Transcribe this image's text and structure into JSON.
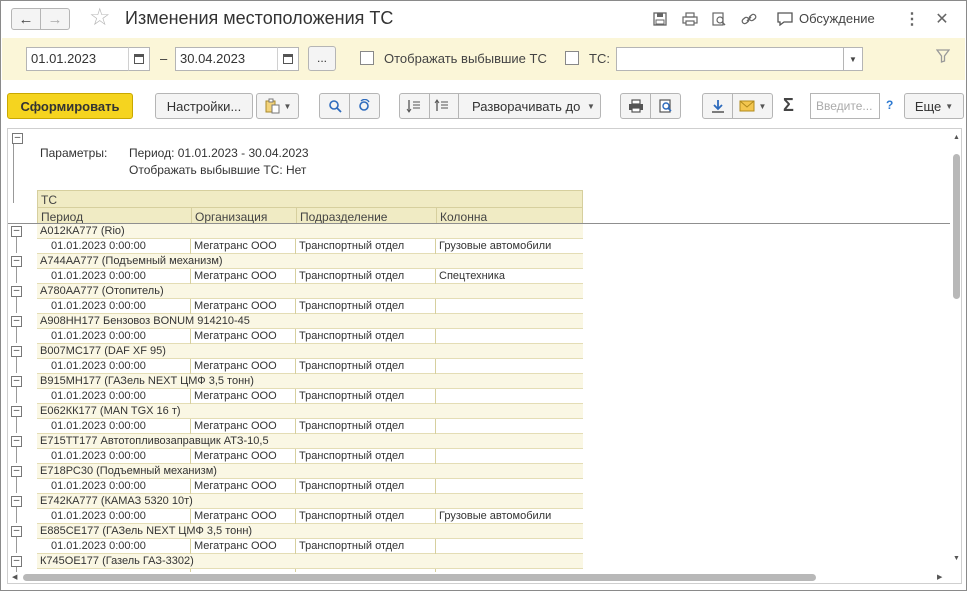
{
  "window": {
    "title": "Изменения местоположения ТС",
    "discuss_label": "Обсуждение"
  },
  "filters": {
    "date_from": "01.01.2023",
    "date_to": "30.04.2023",
    "dash": "–",
    "dots": "...",
    "show_retired_label": "Отображать выбывшие ТС",
    "ts_label": "ТС:",
    "ts_value": ""
  },
  "toolbar": {
    "generate": "Сформировать",
    "settings": "Настройки...",
    "expand_to": "Разворачивать до",
    "search_placeholder": "Введите...",
    "help": "?",
    "more": "Еще",
    "sigma": "Σ"
  },
  "report": {
    "params_label": "Параметры:",
    "period_line": "Период: 01.01.2023 - 30.04.2023",
    "retired_line": "Отображать выбывшие ТС: Нет",
    "header_group": "ТС",
    "columns": [
      "Период",
      "Организация",
      "Подразделение",
      "Колонна"
    ],
    "groups": [
      {
        "name": "А012КА777 (Rio)",
        "row": [
          "01.01.2023 0:00:00",
          "Мегатранс ООО",
          "Транспортный отдел",
          "Грузовые автомобили"
        ]
      },
      {
        "name": "А744АА777 (Подъемный механизм)",
        "row": [
          "01.01.2023 0:00:00",
          "Мегатранс ООО",
          "Транспортный отдел",
          "Спецтехника"
        ]
      },
      {
        "name": "А780АА777 (Отопитель)",
        "row": [
          "01.01.2023 0:00:00",
          "Мегатранс ООО",
          "Транспортный отдел",
          ""
        ]
      },
      {
        "name": "А908НН177 Бензовоз BONUM 914210-45",
        "row": [
          "01.01.2023 0:00:00",
          "Мегатранс ООО",
          "Транспортный отдел",
          ""
        ]
      },
      {
        "name": "В007МС177 (DAF XF 95)",
        "row": [
          "01.01.2023 0:00:00",
          "Мегатранс ООО",
          "Транспортный отдел",
          ""
        ]
      },
      {
        "name": "В915МН177 (ГАЗель NEXT ЦМФ 3,5 тонн)",
        "row": [
          "01.01.2023 0:00:00",
          "Мегатранс ООО",
          "Транспортный отдел",
          ""
        ]
      },
      {
        "name": "Е062КК177 (MAN TGX 16 т)",
        "row": [
          "01.01.2023 0:00:00",
          "Мегатранс ООО",
          "Транспортный отдел",
          ""
        ]
      },
      {
        "name": "Е715ТТ177 Автотопливозаправщик АТЗ-10,5",
        "row": [
          "01.01.2023 0:00:00",
          "Мегатранс ООО",
          "Транспортный отдел",
          ""
        ]
      },
      {
        "name": "Е718РС30 (Подъемный механизм)",
        "row": [
          "01.01.2023 0:00:00",
          "Мегатранс ООО",
          "Транспортный отдел",
          ""
        ]
      },
      {
        "name": "Е742КА777 (КАМАЗ 5320 10т)",
        "row": [
          "01.01.2023 0:00:00",
          "Мегатранс ООО",
          "Транспортный отдел",
          "Грузовые автомобили"
        ]
      },
      {
        "name": "Е885СЕ177 (ГАЗель NEXT ЦМФ 3,5 тонн)",
        "row": [
          "01.01.2023 0:00:00",
          "Мегатранс ООО",
          "Транспортный отдел",
          ""
        ]
      },
      {
        "name": "К745ОЕ177 (Газель ГАЗ-3302)",
        "row": [
          "",
          "",
          "",
          ""
        ]
      }
    ]
  },
  "colors": {
    "primary_button": "#f5d41f",
    "filter_bg": "#fbf6d8",
    "table_header_bg": "#f0ebc4"
  }
}
